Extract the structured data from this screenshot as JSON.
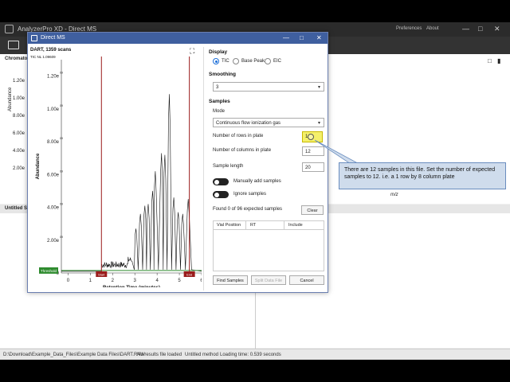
{
  "app": {
    "title": "AnalyzerPro XD - Direct MS",
    "menu": [
      "Preferences",
      "About"
    ],
    "left_panel_title": "Chromato",
    "y_axis_label": "Abundance",
    "y_ticks": [
      "1.20e",
      "1.00e",
      "8.00e",
      "6.00e",
      "4.00e",
      "2.00e"
    ],
    "x_axis_label": "m/z",
    "lower_panel_title": "Untitled Sa"
  },
  "status": {
    "path": "D:\\Download\\Example_Data_Files\\Example Data Files\\DART.RAW",
    "results": "No results file loaded",
    "method": "Untitled method",
    "loading": "Loading time: 0.539 seconds"
  },
  "dialog": {
    "title": "Direct MS",
    "chart_title": "DART, 1359 scans",
    "tic_label": "TIC NL 1.09609",
    "threshold_label": "Threshold",
    "start_label": "Start",
    "end_label": "End",
    "display_label": "Display",
    "display_options": [
      "TIC",
      "Base Peak",
      "EIC"
    ],
    "display_selected": "TIC",
    "smoothing_label": "Smoothing",
    "smoothing_value": "3",
    "samples_label": "Samples",
    "mode_label": "Mode",
    "mode_value": "Continuous flow ionization gas",
    "rows_label": "Number of rows in plate",
    "rows_value": "1",
    "columns_label": "Number of columns in plate",
    "columns_value": "12",
    "sample_length_label": "Sample length",
    "sample_length_value": "20",
    "manual_label": "Manually add samples",
    "ignore_label": "Ignore samples",
    "found_text": "Found 0 of 96 expected samples",
    "clear_label": "Clear",
    "table_headers": [
      "Vial Position",
      "RT",
      "Include"
    ],
    "find_label": "Find Samples",
    "split_label": "Split Data File",
    "cancel_label": "Cancel"
  },
  "chart_data": {
    "type": "line",
    "title": "DART, 1359 scans",
    "xlabel": "Retention Time (minutes)",
    "ylabel": "Abundance",
    "x_ticks": [
      0,
      1,
      2,
      3,
      4,
      5,
      6
    ],
    "y_ticks": [
      "1.20e",
      "1.00e",
      "8.00e",
      "6.00e",
      "4.00e",
      "2.00e",
      "0"
    ],
    "y_tick_exponent": "09",
    "xlim": [
      -0.3,
      6
    ],
    "ylim": [
      0,
      1.3
    ],
    "start_marker": 1.5,
    "end_marker": 5.45,
    "peaks": [
      {
        "x": 3.05,
        "y": 0.27
      },
      {
        "x": 3.25,
        "y": 0.36
      },
      {
        "x": 3.45,
        "y": 0.41
      },
      {
        "x": 3.6,
        "y": 0.42
      },
      {
        "x": 3.8,
        "y": 0.5
      },
      {
        "x": 3.92,
        "y": 0.62
      },
      {
        "x": 4.2,
        "y": 0.73
      },
      {
        "x": 4.35,
        "y": 0.72
      },
      {
        "x": 4.55,
        "y": 1.09
      },
      {
        "x": 4.75,
        "y": 0.46
      },
      {
        "x": 4.95,
        "y": 0.37
      },
      {
        "x": 5.15,
        "y": 0.36
      },
      {
        "x": 5.4,
        "y": 0.45
      }
    ]
  },
  "callout": {
    "text": "There are 12 samples in this file. Set the number of expected samples to 12. i.e. a 1 row by 8 column plate"
  },
  "colors": {
    "dialog_title_bg": "#3f5f9f",
    "marker_red": "#9b1c1c",
    "threshold_green": "#2e8b2e",
    "callout_bg": "#cfdcec",
    "highlight": "#f4f06a"
  }
}
